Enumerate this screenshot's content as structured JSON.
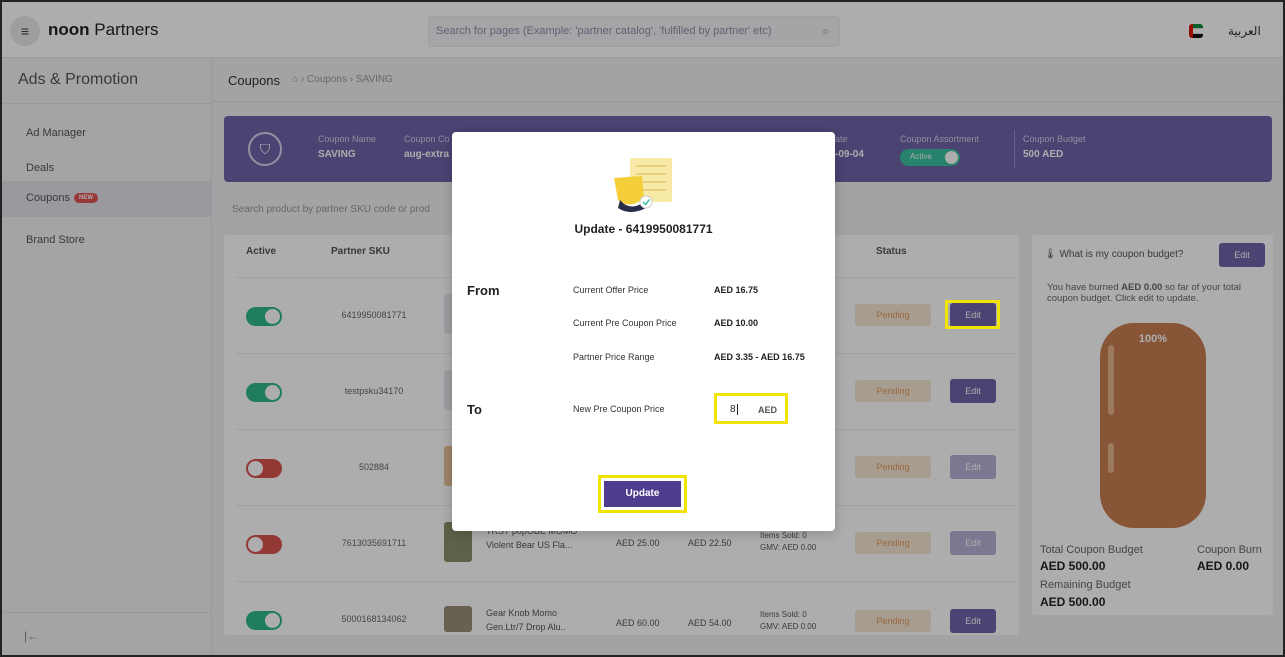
{
  "header": {
    "brand_bold": "noon",
    "brand_rest": " Partners",
    "search_placeholder": "Search for pages (Example: 'partner catalog', 'fulfilled by partner' etc)",
    "language": "العربية"
  },
  "sidebar": {
    "title": "Ads & Promotion",
    "items": [
      {
        "label": "Ad Manager"
      },
      {
        "label": "Deals"
      },
      {
        "label": "Coupons",
        "badge": "NEW"
      },
      {
        "label": "Brand Store"
      }
    ]
  },
  "page": {
    "title": "Coupons",
    "breadcrumb": "› Coupons › SAVING"
  },
  "banner": {
    "fields": [
      {
        "key": "Coupon Name",
        "value": "SAVING"
      },
      {
        "key": "Coupon Co",
        "value": "aug-extra"
      },
      {
        "key": "ate",
        "value": "-09-04"
      },
      {
        "key": "Coupon Assortment",
        "value": "Active"
      },
      {
        "key": "Coupon Budget",
        "value": "500 AED"
      }
    ]
  },
  "product_search": {
    "placeholder": "Search product by partner SKU code or prod"
  },
  "table": {
    "headers": {
      "active": "Active",
      "sku": "Partner SKU",
      "status": "Status"
    },
    "rows": [
      {
        "active": true,
        "sku": "6419950081771",
        "name": "",
        "price1": "",
        "price2": "",
        "items": "",
        "gmv": "",
        "status": "Pending",
        "edit": "Edit",
        "edit_enabled": true
      },
      {
        "active": true,
        "sku": "testpsku34170",
        "name": "",
        "price1": "",
        "price2": "",
        "items": "",
        "gmv": "",
        "status": "Pending",
        "edit": "Edit",
        "edit_enabled": true
      },
      {
        "active": false,
        "sku": "502884",
        "name": "",
        "price1": "",
        "price2": "",
        "items": "",
        "gmv": "",
        "status": "Pending",
        "edit": "Edit",
        "edit_enabled": false
      },
      {
        "active": false,
        "sku": "7613035691711",
        "name": "TRST popOBE MOMO Violent Bear US Fla...",
        "price1": "AED 25.00",
        "price2": "AED 22.50",
        "items": "Items Sold: 0",
        "gmv": "GMV: AED 0.00",
        "status": "Pending",
        "edit": "Edit",
        "edit_enabled": false
      },
      {
        "active": true,
        "sku": "5000168134062",
        "name": "Gear Knob Momo Gen.Ltr/7 Drop Alu..",
        "price1": "AED 60.00",
        "price2": "AED 54.00",
        "items": "Items Sold: 0",
        "gmv": "GMV: AED 0.00",
        "status": "Pending",
        "edit": "Edit",
        "edit_enabled": true
      }
    ]
  },
  "budget": {
    "question": "What is my coupon budget?",
    "edit": "Edit",
    "desc_pre": "You have burned ",
    "desc_amount": "AED 0.00",
    "desc_post": " so far of your total coupon budget. Click edit to update.",
    "percent": "100%",
    "total_label": "Total Coupon Budget",
    "total_value": "AED 500.00",
    "burn_label": "Coupon Burn",
    "burn_value": "AED 0.00",
    "remaining_label": "Remaining Budget",
    "remaining_value": "AED 500.00"
  },
  "modal": {
    "title": "Update - 6419950081771",
    "from_label": "From",
    "to_label": "To",
    "current_offer_label": "Current Offer Price",
    "current_offer_value": "AED 16.75",
    "current_pre_label": "Current Pre Coupon Price",
    "current_pre_value": "AED 10.00",
    "range_label": "Partner Price Range",
    "range_value": "AED 3.35 - AED 16.75",
    "new_pre_label": "New Pre Coupon Price",
    "new_pre_value": "8",
    "currency": "AED",
    "update_button": "Update"
  },
  "colors": {
    "brand_purple": "#6f63a8",
    "update_purple": "#4e3d8e",
    "highlight_yellow": "#f0e400",
    "pending_text": "#e39a5b",
    "active_green": "#2fb98a",
    "inactive_red": "#d9534f"
  }
}
